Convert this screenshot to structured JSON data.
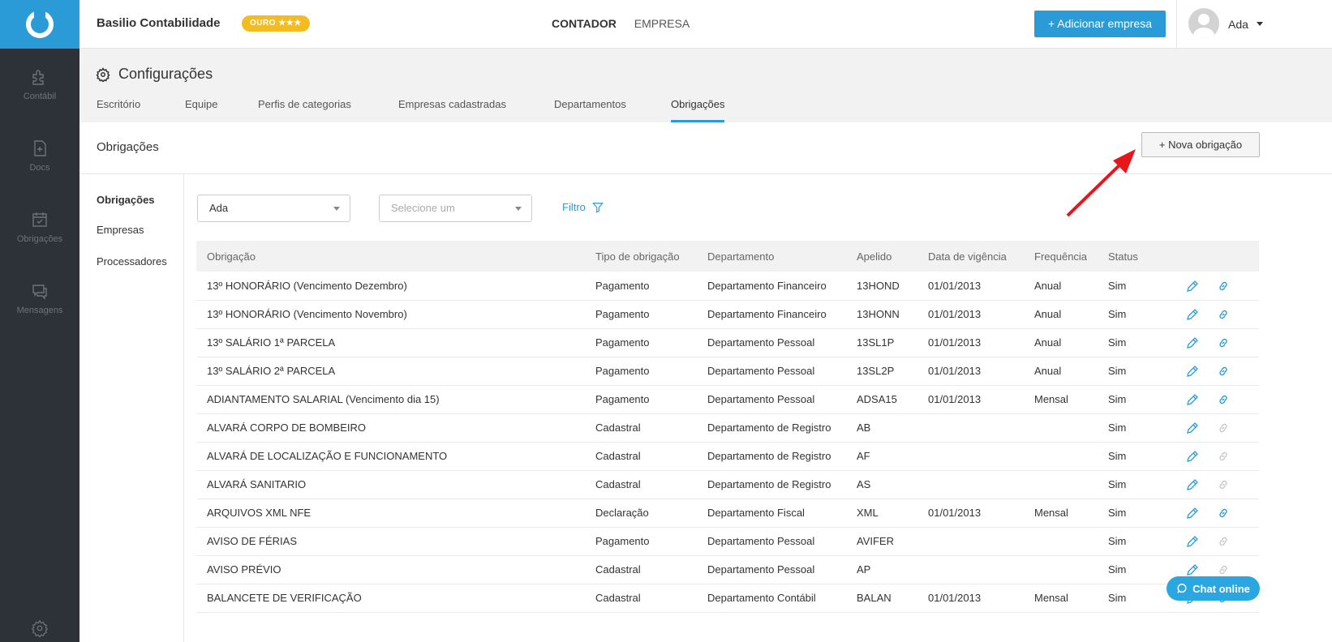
{
  "leftnav": {
    "items": [
      {
        "label": "Contábil",
        "icon": "puzzle-icon"
      },
      {
        "label": "Docs",
        "icon": "document-icon"
      },
      {
        "label": "Obrigações",
        "icon": "calendar-check-icon"
      },
      {
        "label": "Mensagens",
        "icon": "chat-icon"
      }
    ]
  },
  "topbar": {
    "company": "Basilio Contabilidade",
    "badge": "OURO ★★★",
    "nav": [
      "CONTADOR",
      "EMPRESA"
    ],
    "add_button": "+ Adicionar empresa",
    "user": "Ada"
  },
  "config": {
    "title": "Configurações",
    "tabs": [
      "Escritório",
      "Equipe",
      "Perfis de categorias",
      "Empresas cadastradas",
      "Departamentos",
      "Obrigações"
    ]
  },
  "section": {
    "title": "Obrigações",
    "new_button": "+ Nova obrigação"
  },
  "submenu": [
    "Obrigações",
    "Empresas",
    "Processadores"
  ],
  "filters": {
    "user_value": "Ada",
    "select_placeholder": "Selecione um",
    "filter_label": "Filtro"
  },
  "table": {
    "headers": [
      "Obrigação",
      "Tipo de obrigação",
      "Departamento",
      "Apelido",
      "Data de vigência",
      "Frequência",
      "Status"
    ],
    "rows": [
      [
        "13º HONORÁRIO (Vencimento Dezembro)",
        "Pagamento",
        "Departamento Financeiro",
        "13HOND",
        "01/01/2013",
        "Anual",
        "Sim"
      ],
      [
        "13º HONORÁRIO (Vencimento Novembro)",
        "Pagamento",
        "Departamento Financeiro",
        "13HONN",
        "01/01/2013",
        "Anual",
        "Sim"
      ],
      [
        "13º SALÁRIO 1ª PARCELA",
        "Pagamento",
        "Departamento Pessoal",
        "13SL1P",
        "01/01/2013",
        "Anual",
        "Sim"
      ],
      [
        "13º SALÁRIO 2ª PARCELA",
        "Pagamento",
        "Departamento Pessoal",
        "13SL2P",
        "01/01/2013",
        "Anual",
        "Sim"
      ],
      [
        "ADIANTAMENTO SALARIAL (Vencimento dia 15)",
        "Pagamento",
        "Departamento Pessoal",
        "ADSA15",
        "01/01/2013",
        "Mensal",
        "Sim"
      ],
      [
        "ALVARÁ CORPO DE BOMBEIRO",
        "Cadastral",
        "Departamento de Registro",
        "AB",
        "",
        "",
        "Sim"
      ],
      [
        "ALVARÁ DE LOCALIZAÇÃO E FUNCIONAMENTO",
        "Cadastral",
        "Departamento de Registro",
        "AF",
        "",
        "",
        "Sim"
      ],
      [
        "ALVARÁ SANITARIO",
        "Cadastral",
        "Departamento de Registro",
        "AS",
        "",
        "",
        "Sim"
      ],
      [
        "ARQUIVOS XML NFE",
        "Declaração",
        "Departamento Fiscal",
        "XML",
        "01/01/2013",
        "Mensal",
        "Sim"
      ],
      [
        "AVISO DE FÉRIAS",
        "Pagamento",
        "Departamento Pessoal",
        "AVIFER",
        "",
        "",
        "Sim"
      ],
      [
        "AVISO PRÉVIO",
        "Cadastral",
        "Departamento Pessoal",
        "AP",
        "",
        "",
        "Sim"
      ],
      [
        "BALANCETE DE VERIFICAÇÃO",
        "Cadastral",
        "Departamento Contábil",
        "BALAN",
        "01/01/2013",
        "Mensal",
        "Sim"
      ]
    ],
    "link_active": [
      true,
      true,
      true,
      true,
      true,
      false,
      false,
      false,
      true,
      false,
      false,
      true
    ]
  },
  "chat": {
    "label": "Chat online"
  },
  "colors": {
    "accent": "#2a9bd6",
    "nav_bg": "#2c3237",
    "badge": "#f3bd22",
    "arrow": "#e8151b"
  }
}
